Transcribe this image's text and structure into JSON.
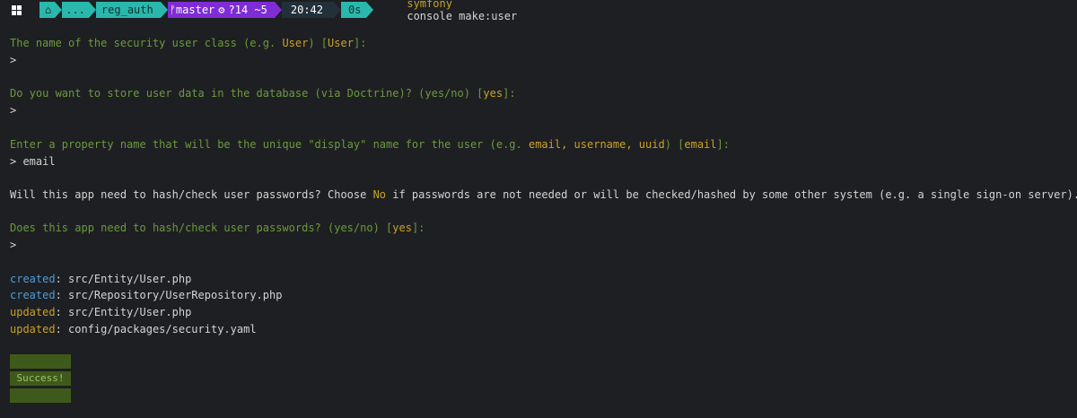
{
  "prompt": {
    "home_icon": "home-icon",
    "ellipsis": "...",
    "folder": "reg_auth",
    "branch": "master",
    "git_status": "?14 ~5",
    "time": "20:42",
    "duration": "0s",
    "command_name": "symfony",
    "command_args": "console make:user"
  },
  "q1": {
    "text": "The name of the security user class (e.g. ",
    "example": "User",
    "close": ") [",
    "default": "User",
    "end": "]:",
    "answer": ">"
  },
  "q2": {
    "text": "Do you want to store user data in the database (via Doctrine)? (yes/no) [",
    "default": "yes",
    "end": "]:",
    "answer": ">"
  },
  "q3": {
    "text": "Enter a property name that will be the unique \"display\" name for the user (e.g. ",
    "example": "email, username, uuid",
    "close": ") [",
    "default": "email",
    "end": "]:",
    "answer": "> email"
  },
  "info": {
    "pre": "Will this app need to hash/check user passwords? Choose ",
    "no": "No",
    "post": " if passwords are not needed or will be checked/hashed by some other system (e.g. a single sign-on server)."
  },
  "q4": {
    "text": "Does this app need to hash/check user passwords? (yes/no) [",
    "default": "yes",
    "end": "]:",
    "answer": ">"
  },
  "files": [
    {
      "action": "created",
      "path": ": src/Entity/User.php"
    },
    {
      "action": "created",
      "path": ": src/Repository/UserRepository.php"
    },
    {
      "action": "updated",
      "path": ": src/Entity/User.php"
    },
    {
      "action": "updated",
      "path": ": config/packages/security.yaml"
    }
  ],
  "success": "Success!",
  "colors": {
    "background": "#1e1f22",
    "question": "#6a9a3e",
    "highlight": "#c9a227",
    "created": "#4a9ddb",
    "success_bg": "#3e5a1a"
  }
}
